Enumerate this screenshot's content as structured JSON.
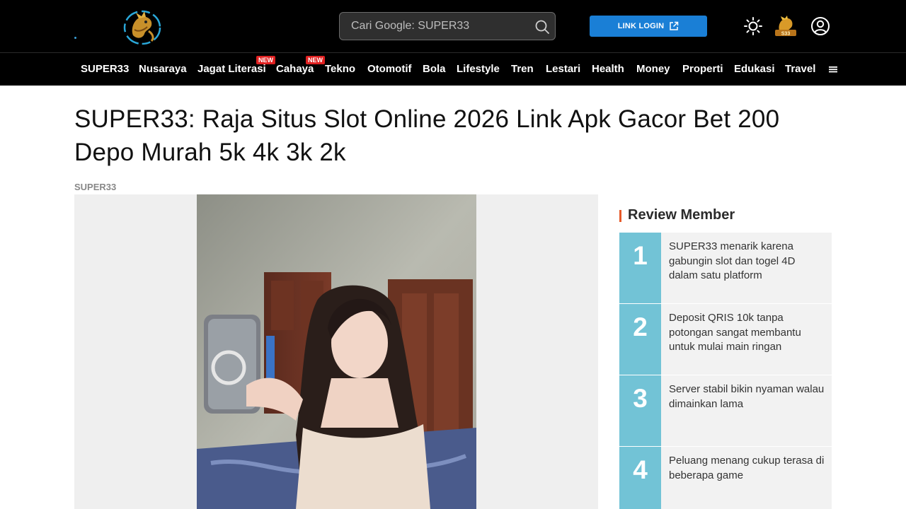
{
  "header": {
    "search": {
      "placeholder": "Cari Google: SUPER33"
    },
    "login_label": "LINK LOGIN",
    "icons": [
      "logo-dragon",
      "search-icon",
      "external-link-icon",
      "sun-icon",
      "mascot-logo",
      "user-icon"
    ]
  },
  "nav": {
    "items": [
      {
        "label": "SUPER33"
      },
      {
        "label": "Nusaraya"
      },
      {
        "label": "Jagat Literasi",
        "badge": "NEW"
      },
      {
        "label": "Cahaya",
        "badge": "NEW"
      },
      {
        "label": "Tekno"
      },
      {
        "label": "Otomotif"
      },
      {
        "label": "Bola"
      },
      {
        "label": "Lifestyle"
      },
      {
        "label": "Tren"
      },
      {
        "label": "Lestari"
      },
      {
        "label": "Health"
      },
      {
        "label": "Money"
      },
      {
        "label": "Properti"
      },
      {
        "label": "Edukasi"
      },
      {
        "label": "Travel"
      }
    ]
  },
  "article": {
    "title": "SUPER33: Raja Situs Slot Online 2026 Link Apk Gacor Bet 200 Depo Murah 5k 4k 3k 2k",
    "author": "SUPER33"
  },
  "sidebar": {
    "title": "Review Member",
    "reviews": [
      {
        "num": "1",
        "text": "SUPER33 menarik karena gabungin slot dan togel 4D dalam satu platform"
      },
      {
        "num": "2",
        "text": "Deposit QRIS 10k tanpa potongan sangat membantu untuk mulai main ringan"
      },
      {
        "num": "3",
        "text": "Server stabil bikin nyaman walau dimainkan lama"
      },
      {
        "num": "4",
        "text": "Peluang menang cukup terasa di beberapa game"
      }
    ]
  },
  "colors": {
    "header_bg": "#000000",
    "login_button": "#1a7fd6",
    "badge": "#e02020",
    "review_number_bg": "#72c3d6",
    "section_accent": "#e65a2a"
  }
}
